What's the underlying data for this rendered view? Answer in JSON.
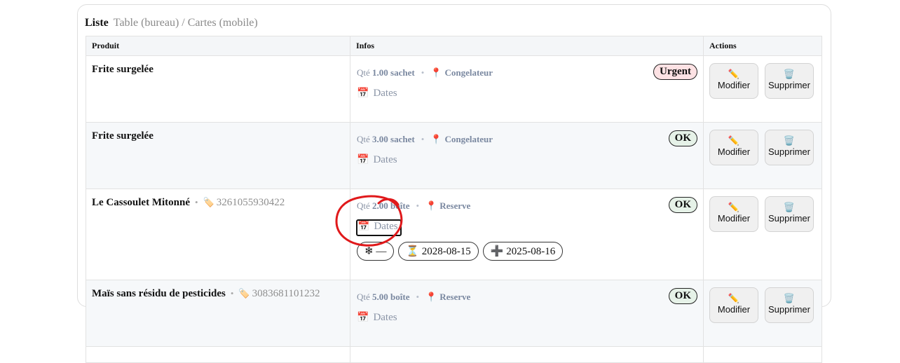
{
  "header": {
    "title": "Liste",
    "subtitle": "Table (bureau) / Cartes (mobile)"
  },
  "columns": {
    "product": "Produit",
    "info": "Infos",
    "actions": "Actions"
  },
  "labels": {
    "qty_prefix": "Qté",
    "dates": "Dates",
    "edit": "Modifier",
    "delete": "Supprimer"
  },
  "icons": {
    "location": "pin-icon",
    "calendar": "calendar-icon",
    "barcode": "tag-icon",
    "edit": "pencil-icon",
    "delete": "trash-icon",
    "freeze": "snowflake-icon",
    "expiry": "hourglass-icon",
    "added": "plus-icon"
  },
  "rows": [
    {
      "name": "Frite surgelée",
      "barcode": "",
      "qty": "1.00 sachet",
      "location": "Congelateur",
      "status": "Urgent"
    },
    {
      "name": "Frite surgelée",
      "barcode": "",
      "qty": "3.00 sachet",
      "location": "Congelateur",
      "status": "OK"
    },
    {
      "name": "Le Cassoulet Mitonné",
      "barcode": "3261055930422",
      "qty": "2.00 boîte",
      "location": "Reserve",
      "status": "OK",
      "chips": {
        "freeze": "—",
        "expiry": "2028-08-15",
        "added": "2025-08-16"
      }
    },
    {
      "name": "Maïs sans résidu de pesticides",
      "barcode": "3083681101232",
      "qty": "5.00 boîte",
      "location": "Reserve",
      "status": "OK"
    }
  ],
  "colors": {
    "urgent_bg": "#fde2e4",
    "ok_bg": "#e6f2e8",
    "annotation": "#e0191b"
  }
}
